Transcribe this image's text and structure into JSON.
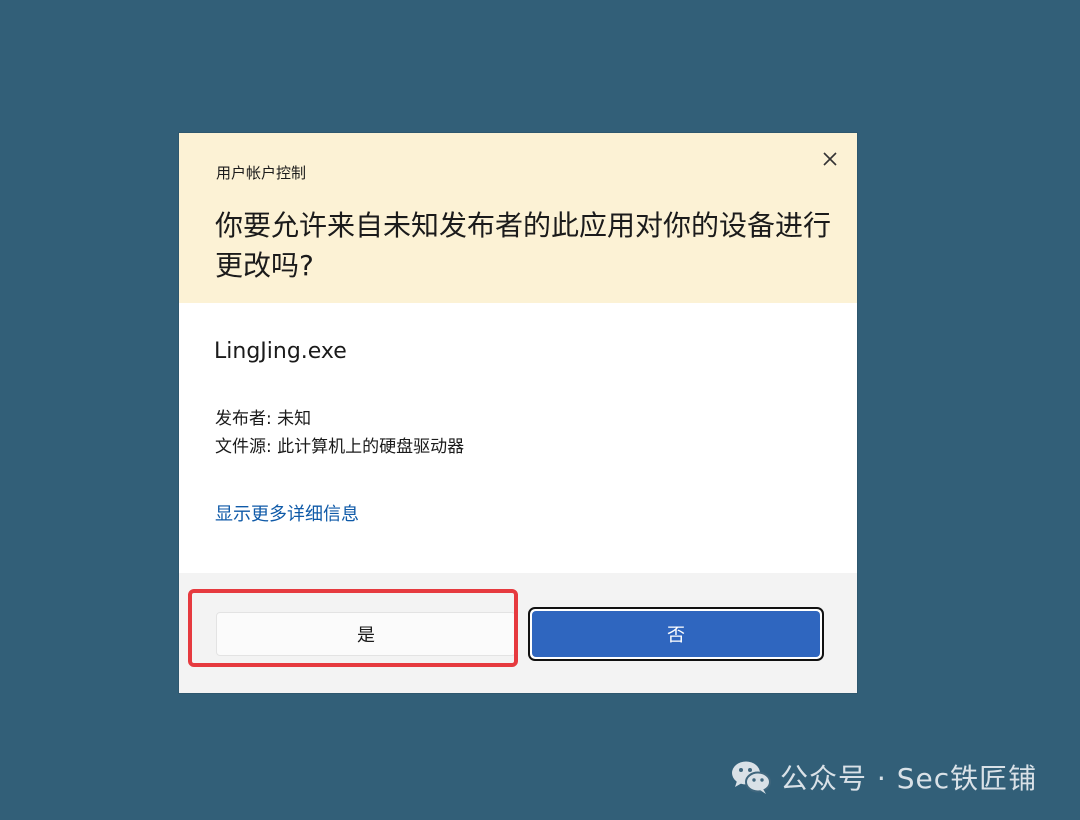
{
  "dialog": {
    "caption": "用户帐户控制",
    "question": "你要允许来自未知发布者的此应用对你的设备进行更改吗?",
    "app_name": "LingJing.exe",
    "publisher_line": "发布者: 未知",
    "source_line": "文件源: 此计算机上的硬盘驱动器",
    "details_link": "显示更多详细信息",
    "yes_label": "是",
    "no_label": "否"
  },
  "watermark": {
    "text": "公众号 · Sec铁匠铺",
    "icon": "wechat-icon"
  },
  "colors": {
    "desktop": "#325f78",
    "header": "#fcf2d5",
    "link": "#0f5aa8",
    "primary": "#2f66bf",
    "highlight": "#e63a3f"
  }
}
